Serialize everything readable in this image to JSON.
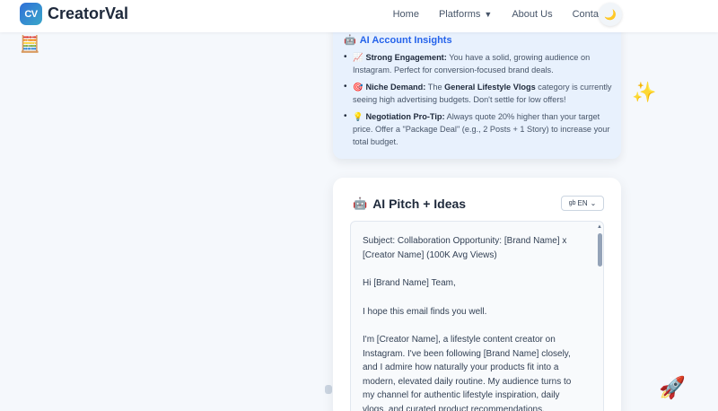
{
  "header": {
    "logo_badge": "CV",
    "logo_text": "CreatorVal",
    "nav": [
      {
        "label": "Home"
      },
      {
        "label": "Platforms",
        "has_dropdown": true
      },
      {
        "label": "About Us"
      },
      {
        "label": "Contact Us"
      }
    ],
    "theme_toggle_icon": "moon-icon"
  },
  "decor": {
    "top_left_icon": "calculator-icon",
    "right_icon": "sparkle-icon",
    "bottom_right_icon": "rocket-icon"
  },
  "insights": {
    "title": "AI Account Insights",
    "title_icon": "robot-icon",
    "items": [
      {
        "icon": "chart-icon",
        "bold": "Strong Engagement:",
        "text": " You have a solid, growing audience on Instagram. Perfect for conversion-focused brand deals."
      },
      {
        "icon": "target-icon",
        "bold": "Niche Demand:",
        "text_before": " The ",
        "bold2": "General Lifestyle Vlogs",
        "text": " category is currently seeing high advertising budgets. Don't settle for low offers!"
      },
      {
        "icon": "lightbulb-icon",
        "bold": "Negotiation Pro-Tip:",
        "text": " Always quote 20% higher than your target price. Offer a \"Package Deal\" (e.g., 2 Posts + 1 Story) to increase your total budget."
      }
    ]
  },
  "pitch": {
    "title": "AI Pitch + Ideas",
    "title_icon": "robot-icon",
    "language": "EN",
    "language_flag": "gb",
    "email_paragraphs": [
      "Subject: Collaboration Opportunity: [Brand Name] x [Creator Name] (100K Avg Views)",
      "Hi [Brand Name] Team,",
      "I hope this email finds you well.",
      "I'm [Creator Name], a lifestyle content creator on Instagram. I've been following [Brand Name] closely, and I admire how naturally your products fit into a modern, elevated daily routine. My audience turns to my channel for authentic lifestyle inspiration, daily vlogs, and curated product recommendations."
    ]
  },
  "colors": {
    "accent": "#2563eb",
    "insights_bg": "#e8f1fd",
    "page_bg": "#f5f8fc"
  }
}
